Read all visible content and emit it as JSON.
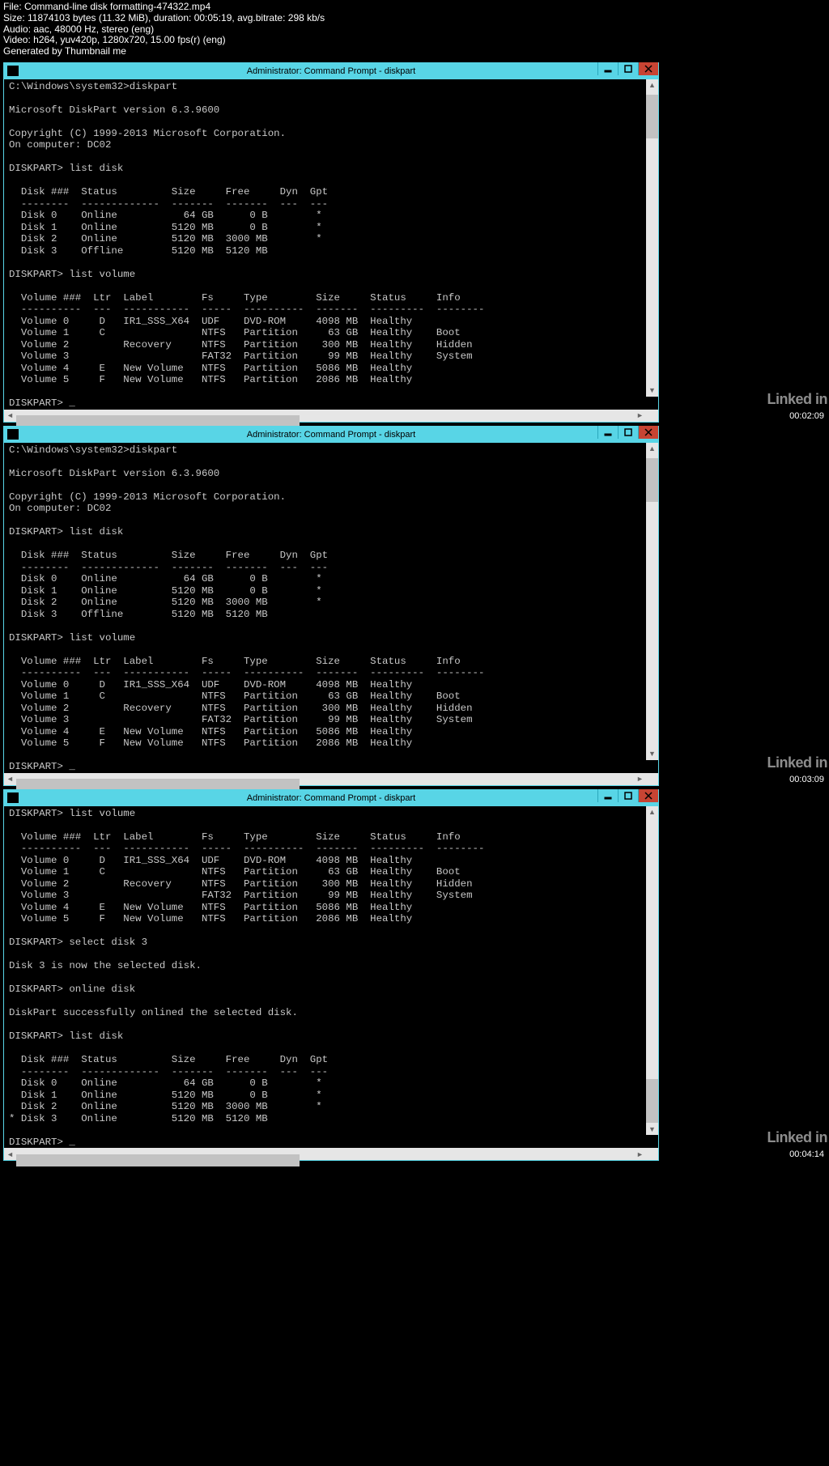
{
  "meta": {
    "l1": "File: Command-line disk formatting-474322.mp4",
    "l2": "Size: 11874103 bytes (11.32 MiB), duration: 00:05:19, avg.bitrate: 298 kb/s",
    "l3": "Audio: aac, 48000 Hz, stereo (eng)",
    "l4": "Video: h264, yuv420p, 1280x720, 15.00 fps(r) (eng)",
    "l5": "Generated by Thumbnail me"
  },
  "window_title": "Administrator: Command Prompt - diskpart",
  "watermark": "Linked in",
  "ts1": "00:02:09",
  "ts2": "00:03:09",
  "ts3": "00:04:14",
  "term1": "C:\\Windows\\system32>diskpart\n\nMicrosoft DiskPart version 6.3.9600\n\nCopyright (C) 1999-2013 Microsoft Corporation.\nOn computer: DC02\n\nDISKPART> list disk\n\n  Disk ###  Status         Size     Free     Dyn  Gpt\n  --------  -------------  -------  -------  ---  ---\n  Disk 0    Online           64 GB      0 B        *\n  Disk 1    Online         5120 MB      0 B        *\n  Disk 2    Online         5120 MB  3000 MB        *\n  Disk 3    Offline        5120 MB  5120 MB\n\nDISKPART> list volume\n\n  Volume ###  Ltr  Label        Fs     Type        Size     Status     Info\n  ----------  ---  -----------  -----  ----------  -------  ---------  --------\n  Volume 0     D   IR1_SSS_X64  UDF    DVD-ROM     4098 MB  Healthy\n  Volume 1     C                NTFS   Partition     63 GB  Healthy    Boot\n  Volume 2         Recovery     NTFS   Partition    300 MB  Healthy    Hidden\n  Volume 3                      FAT32  Partition     99 MB  Healthy    System\n  Volume 4     E   New Volume   NTFS   Partition   5086 MB  Healthy\n  Volume 5     F   New Volume   NTFS   Partition   2086 MB  Healthy\n\nDISKPART> _",
  "term2": "C:\\Windows\\system32>diskpart\n\nMicrosoft DiskPart version 6.3.9600\n\nCopyright (C) 1999-2013 Microsoft Corporation.\nOn computer: DC02\n\nDISKPART> list disk\n\n  Disk ###  Status         Size     Free     Dyn  Gpt\n  --------  -------------  -------  -------  ---  ---\n  Disk 0    Online           64 GB      0 B        *\n  Disk 1    Online         5120 MB      0 B        *\n  Disk 2    Online         5120 MB  3000 MB        *\n  Disk 3    Offline        5120 MB  5120 MB\n\nDISKPART> list volume\n\n  Volume ###  Ltr  Label        Fs     Type        Size     Status     Info\n  ----------  ---  -----------  -----  ----------  -------  ---------  --------\n  Volume 0     D   IR1_SSS_X64  UDF    DVD-ROM     4098 MB  Healthy\n  Volume 1     C                NTFS   Partition     63 GB  Healthy    Boot\n  Volume 2         Recovery     NTFS   Partition    300 MB  Healthy    Hidden\n  Volume 3                      FAT32  Partition     99 MB  Healthy    System\n  Volume 4     E   New Volume   NTFS   Partition   5086 MB  Healthy\n  Volume 5     F   New Volume   NTFS   Partition   2086 MB  Healthy\n\nDISKPART> _",
  "term3": "DISKPART> list volume\n\n  Volume ###  Ltr  Label        Fs     Type        Size     Status     Info\n  ----------  ---  -----------  -----  ----------  -------  ---------  --------\n  Volume 0     D   IR1_SSS_X64  UDF    DVD-ROM     4098 MB  Healthy\n  Volume 1     C                NTFS   Partition     63 GB  Healthy    Boot\n  Volume 2         Recovery     NTFS   Partition    300 MB  Healthy    Hidden\n  Volume 3                      FAT32  Partition     99 MB  Healthy    System\n  Volume 4     E   New Volume   NTFS   Partition   5086 MB  Healthy\n  Volume 5     F   New Volume   NTFS   Partition   2086 MB  Healthy\n\nDISKPART> select disk 3\n\nDisk 3 is now the selected disk.\n\nDISKPART> online disk\n\nDiskPart successfully onlined the selected disk.\n\nDISKPART> list disk\n\n  Disk ###  Status         Size     Free     Dyn  Gpt\n  --------  -------------  -------  -------  ---  ---\n  Disk 0    Online           64 GB      0 B        *\n  Disk 1    Online         5120 MB      0 B        *\n  Disk 2    Online         5120 MB  3000 MB        *\n* Disk 3    Online         5120 MB  5120 MB\n\nDISKPART> _"
}
